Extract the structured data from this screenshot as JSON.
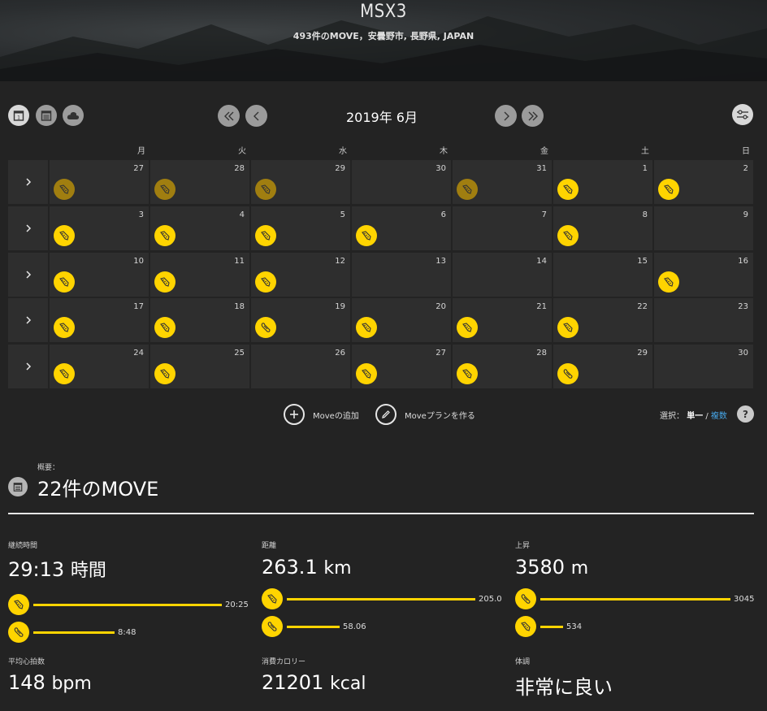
{
  "header": {
    "title": "MSX3",
    "subtitle": "493件のMOVE，安曇野市, 長野県, JAPAN"
  },
  "toolbar": {
    "month": "2019年 6月",
    "left_icons": [
      "calendar-day-icon",
      "calendar-list-icon",
      "cloud-icon"
    ],
    "nav_icons": [
      "double-chevron-left-icon",
      "chevron-left-icon",
      "chevron-right-icon",
      "double-chevron-right-icon"
    ],
    "filter_icon": "filter-sliders-icon"
  },
  "calendar": {
    "weekdays": [
      "月",
      "火",
      "水",
      "木",
      "金",
      "土",
      "日"
    ],
    "weeks": [
      {
        "days": [
          {
            "num": "27",
            "move": "dim"
          },
          {
            "num": "28",
            "move": "dim"
          },
          {
            "num": "29",
            "move": "dim"
          },
          {
            "num": "30",
            "move": ""
          },
          {
            "num": "31",
            "move": "dim"
          },
          {
            "num": "1",
            "move": "run"
          },
          {
            "num": "2",
            "move": "run"
          }
        ]
      },
      {
        "days": [
          {
            "num": "3",
            "move": "run"
          },
          {
            "num": "4",
            "move": "run"
          },
          {
            "num": "5",
            "move": "run"
          },
          {
            "num": "6",
            "move": "run"
          },
          {
            "num": "7",
            "move": ""
          },
          {
            "num": "8",
            "move": "run"
          },
          {
            "num": "9",
            "move": ""
          }
        ]
      },
      {
        "days": [
          {
            "num": "10",
            "move": "run"
          },
          {
            "num": "11",
            "move": "run"
          },
          {
            "num": "12",
            "move": "run"
          },
          {
            "num": "13",
            "move": ""
          },
          {
            "num": "14",
            "move": ""
          },
          {
            "num": "15",
            "move": ""
          },
          {
            "num": "16",
            "move": "run"
          }
        ]
      },
      {
        "days": [
          {
            "num": "17",
            "move": "run"
          },
          {
            "num": "18",
            "move": "run"
          },
          {
            "num": "19",
            "move": "shoe"
          },
          {
            "num": "20",
            "move": "run"
          },
          {
            "num": "21",
            "move": "run"
          },
          {
            "num": "22",
            "move": "run"
          },
          {
            "num": "23",
            "move": ""
          }
        ]
      },
      {
        "days": [
          {
            "num": "24",
            "move": "run"
          },
          {
            "num": "25",
            "move": "run"
          },
          {
            "num": "26",
            "move": ""
          },
          {
            "num": "27",
            "move": "run"
          },
          {
            "num": "28",
            "move": "run"
          },
          {
            "num": "29",
            "move": "shoe"
          },
          {
            "num": "30",
            "move": ""
          }
        ]
      }
    ]
  },
  "actions": {
    "add_move": "Moveの追加",
    "make_plan": "Moveプランを作る",
    "select_prefix": "選択：",
    "select_single": "単一",
    "select_sep": " / ",
    "select_multi": "複数",
    "help": "?"
  },
  "summary": {
    "label": "概要：",
    "title": "22件のMOVE",
    "stats": {
      "duration": {
        "label": "継続時間",
        "value": "29:13",
        "unit": "時間",
        "bars": [
          {
            "icon": "run",
            "value": "20:25",
            "fraction": 1.0
          },
          {
            "icon": "shoe",
            "value": "8:48",
            "fraction": 0.43
          }
        ]
      },
      "distance": {
        "label": "距離",
        "value": "263.1",
        "unit": "km",
        "bars": [
          {
            "icon": "run",
            "value": "205.0",
            "fraction": 1.0
          },
          {
            "icon": "shoe",
            "value": "58.06",
            "fraction": 0.28
          }
        ]
      },
      "ascent": {
        "label": "上昇",
        "value": "3580",
        "unit": "m",
        "bars": [
          {
            "icon": "shoe",
            "value": "3045",
            "fraction": 1.0
          },
          {
            "icon": "run",
            "value": "534",
            "fraction": 0.12
          }
        ]
      },
      "heart_rate": {
        "label": "平均心拍数",
        "value": "148",
        "unit": "bpm"
      },
      "calories": {
        "label": "消費カロリー",
        "value": "21201",
        "unit": "kcal"
      },
      "feeling": {
        "label": "体調",
        "value": "非常に良い"
      }
    }
  },
  "colors": {
    "accent": "#ffd400",
    "accent_dim": "#a07e10",
    "link": "#46a6e8"
  }
}
